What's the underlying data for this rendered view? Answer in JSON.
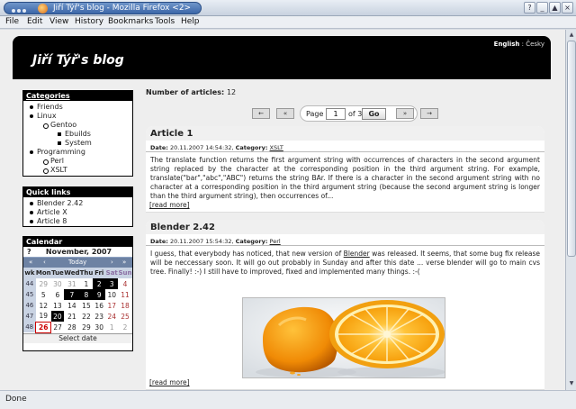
{
  "window": {
    "title": "Jiří Týř's blog - Mozilla Firefox <2>",
    "buttons": [
      "?",
      "_",
      "▲",
      "×"
    ]
  },
  "menubar": {
    "items": [
      "File",
      "Edit",
      "View",
      "History",
      "Bookmarks",
      "Tools",
      "Help"
    ]
  },
  "header": {
    "blog_title": "Jiří Týř's blog",
    "lang_en": "English",
    "lang_sep": " : ",
    "lang_cz": "Česky"
  },
  "categories": {
    "title": "Categories",
    "items": [
      {
        "label": "Friends",
        "level": 1
      },
      {
        "label": "Linux",
        "level": 1
      },
      {
        "label": "Gentoo",
        "level": 2
      },
      {
        "label": "Ebuilds",
        "level": 3
      },
      {
        "label": "System",
        "level": 3
      },
      {
        "label": "Programming",
        "level": 1
      },
      {
        "label": "Perl",
        "level": 2
      },
      {
        "label": "XSLT",
        "level": 2
      }
    ]
  },
  "quicklinks": {
    "title": "Quick links",
    "items": [
      "Blender 2.42",
      "Article X",
      "Article 8"
    ]
  },
  "calendar": {
    "title": "Calendar",
    "help": "?",
    "month": "November, 2007",
    "nav": {
      "prev_year": "«",
      "prev_month": "‹",
      "today": "Today",
      "next_month": "›",
      "next_year": "»"
    },
    "headers": [
      "wk",
      "Mon",
      "Tue",
      "Wed",
      "Thu",
      "Fri",
      "Sat",
      "Sun"
    ],
    "rows": [
      [
        "44",
        "",
        "",
        "",
        "1",
        "2",
        "3",
        "4"
      ],
      [
        "45",
        "5",
        "6",
        "7",
        "8",
        "9",
        "10",
        "11"
      ],
      [
        "46",
        "12",
        "13",
        "14",
        "15",
        "16",
        "17",
        "18"
      ],
      [
        "47",
        "19",
        "20",
        "21",
        "22",
        "23",
        "24",
        "25"
      ],
      [
        "48",
        "26",
        "27",
        "28",
        "29",
        "30",
        "",
        ""
      ]
    ],
    "footer": "Select date"
  },
  "main": {
    "num_articles_label": "Number of articles:",
    "num_articles_value": "12"
  },
  "pager": {
    "first": "←",
    "prev": "«",
    "page_label": "Page",
    "page_value": "1",
    "of_label": "of 3",
    "go": "Go",
    "next": "»",
    "last": "→"
  },
  "articles": [
    {
      "title": "Article 1",
      "date_label": "Date:",
      "date": "20.11.2007 14:54:32,",
      "category_label": "Category:",
      "category": "XSLT",
      "body": "The translate function returns the first argument string with occurrences of characters in the second argument string replaced by the character at the corresponding position in the third argument string. For example, translate(\"bar\",\"abc\",\"ABC\") returns the string BAr. If there is a character in the second argument string with no character at a corresponding position in the third argument string (because the second argument string is longer than the third argument string), then occurrences of...",
      "readmore": "[read more]"
    },
    {
      "title": "Blender 2.42",
      "date_label": "Date:",
      "date": "20.11.2007 15:54:32,",
      "category_label": "Category:",
      "category": "Perl",
      "body_pre": "I guess, that everybody has noticed, that new version of ",
      "body_link": "Blender",
      "body_post": " was released. It seems, that some bug fix release will be neccessary soon. It will go out probably in Sunday and after this date ... verse blender will go to main cvs tree. Finally! :-) I still have to improved, fixed and implemented many things. :-(",
      "readmore": "[read more]"
    }
  ],
  "status": {
    "text": "Done"
  },
  "colors": {
    "header_bg": "#000000",
    "calendar_nav": "#6d82a3",
    "calendar_header": "#c9d3e3",
    "titlebar": "#3c67a8"
  }
}
